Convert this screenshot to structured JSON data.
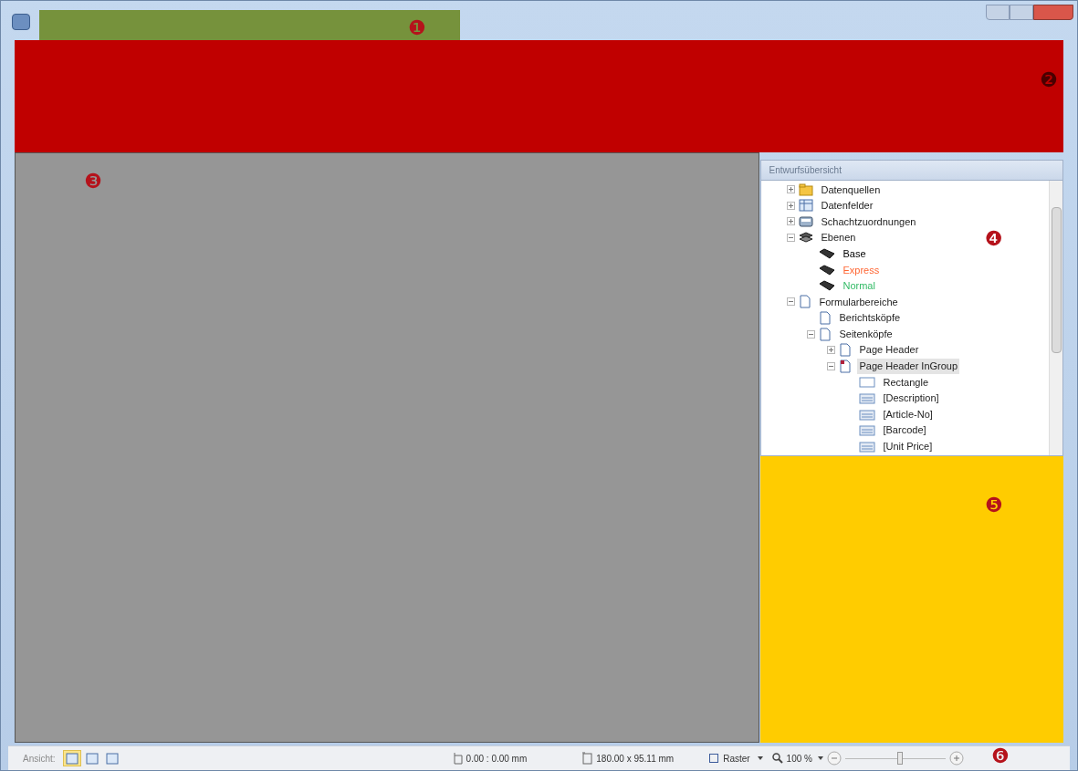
{
  "callouts": [
    "❶",
    "❷",
    "❸",
    "❹",
    "❺",
    "❻"
  ],
  "panel": {
    "title": "Entwurfsübersicht",
    "tree": [
      {
        "label": "Datenquellen",
        "kind": "folder",
        "expanded": false
      },
      {
        "label": "Datenfelder",
        "kind": "fields",
        "expanded": false
      },
      {
        "label": "Schachtzuordnungen",
        "kind": "tray",
        "expanded": false
      },
      {
        "label": "Ebenen",
        "kind": "layers",
        "expanded": true,
        "children": [
          {
            "label": "Base",
            "kind": "layer",
            "color": "#000000"
          },
          {
            "label": "Express",
            "kind": "layer",
            "color": "#ff6633"
          },
          {
            "label": "Normal",
            "kind": "layer",
            "color": "#33bb66"
          }
        ]
      },
      {
        "label": "Formularbereiche",
        "kind": "page",
        "expanded": true,
        "children": [
          {
            "label": "Berichtsköpfe",
            "kind": "page"
          },
          {
            "label": "Seitenköpfe",
            "kind": "page",
            "expanded": true,
            "children": [
              {
                "label": "Page Header",
                "kind": "page",
                "expanded": false,
                "selected": false
              },
              {
                "label": "Page Header InGroup",
                "kind": "page-marked",
                "expanded": true,
                "selected": true,
                "children": [
                  {
                    "label": "Rectangle",
                    "kind": "rect"
                  },
                  {
                    "label": "[Description]",
                    "kind": "text-field"
                  },
                  {
                    "label": "[Article-No]",
                    "kind": "text-field"
                  },
                  {
                    "label": "[Barcode]",
                    "kind": "text-field"
                  },
                  {
                    "label": "[Unit Price]",
                    "kind": "text-field"
                  }
                ]
              }
            ]
          }
        ]
      }
    ]
  },
  "status_bar": {
    "view_label": "Ansicht:",
    "views": [
      {
        "selected": true
      },
      {
        "selected": false
      },
      {
        "selected": false
      }
    ],
    "position": "0.00 : 0.00 mm",
    "size": "180.00 x 95.11 mm",
    "grid": "Raster",
    "zoom": "100 %",
    "zoom_slider": {
      "level": 0.55
    }
  }
}
